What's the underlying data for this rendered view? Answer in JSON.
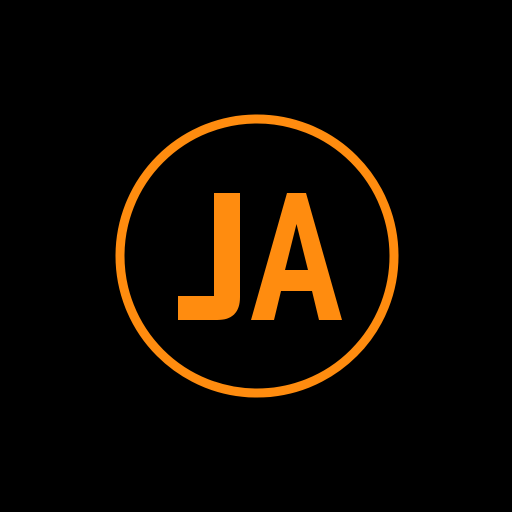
{
  "logo": {
    "monogram": "JA"
  },
  "colors": {
    "background": "#000000",
    "accent": "#FF8C0F"
  }
}
